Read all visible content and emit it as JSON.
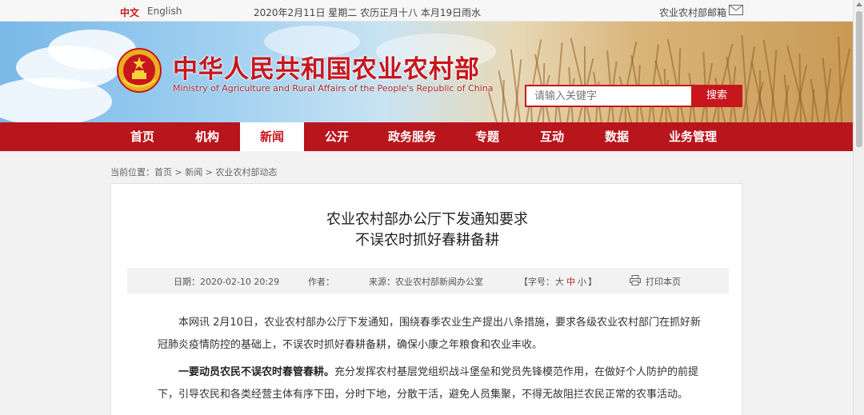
{
  "topbar": {
    "lang_cn": "中文",
    "lang_en": "English",
    "date": "2020年2月11日 星期二 农历正月十八 本月19日雨水",
    "mailbox": "农业农村部邮箱"
  },
  "header": {
    "title": "中华人民共和国农业农村部",
    "subtitle": "Ministry of Agriculture and Rural Affairs of the People's Republic of China",
    "search_placeholder": "请输入关键字",
    "search_button": "搜索"
  },
  "nav": {
    "items": [
      {
        "label": "首页"
      },
      {
        "label": "机构"
      },
      {
        "label": "新闻"
      },
      {
        "label": "公开"
      },
      {
        "label": "政务服务"
      },
      {
        "label": "专题"
      },
      {
        "label": "互动"
      },
      {
        "label": "数据"
      },
      {
        "label": "业务管理"
      }
    ],
    "active_index": 2
  },
  "breadcrumb": "当前位置：首页 > 新闻 > 农业农村部动态",
  "article": {
    "title_line1": "农业农村部办公厅下发通知要求",
    "title_line2": "不误农时抓好春耕备耕",
    "date": "日期：2020-02-10 20:29",
    "author": "作者：",
    "source": "来源：农业农村部新闻办公室",
    "font_label_open": "【字号：",
    "font_big": "大",
    "font_mid": "中",
    "font_small": "小",
    "font_label_close": "】",
    "print": "打印本页",
    "para1": "本网讯 2月10日，农业农村部办公厅下发通知，围绕春季农业生产提出八条措施，要求各级农业农村部门在抓好新冠肺炎疫情防控的基础上，不误农时抓好春耕备耕，确保小康之年粮食和农业丰收。",
    "para2_bold": "一要动员农民不误农时春管春耕。",
    "para2_rest": "充分发挥农村基层党组织战斗堡垒和党员先锋模范作用，在做好个人防护的前提下，引导农民和各类经营主体有序下田，分时下地，分散干活，避免人员集聚，不得无故阻拦农民正常的农事活动。"
  },
  "colors": {
    "brand_red": "#c8161d",
    "nav_red": "#b9151c"
  }
}
